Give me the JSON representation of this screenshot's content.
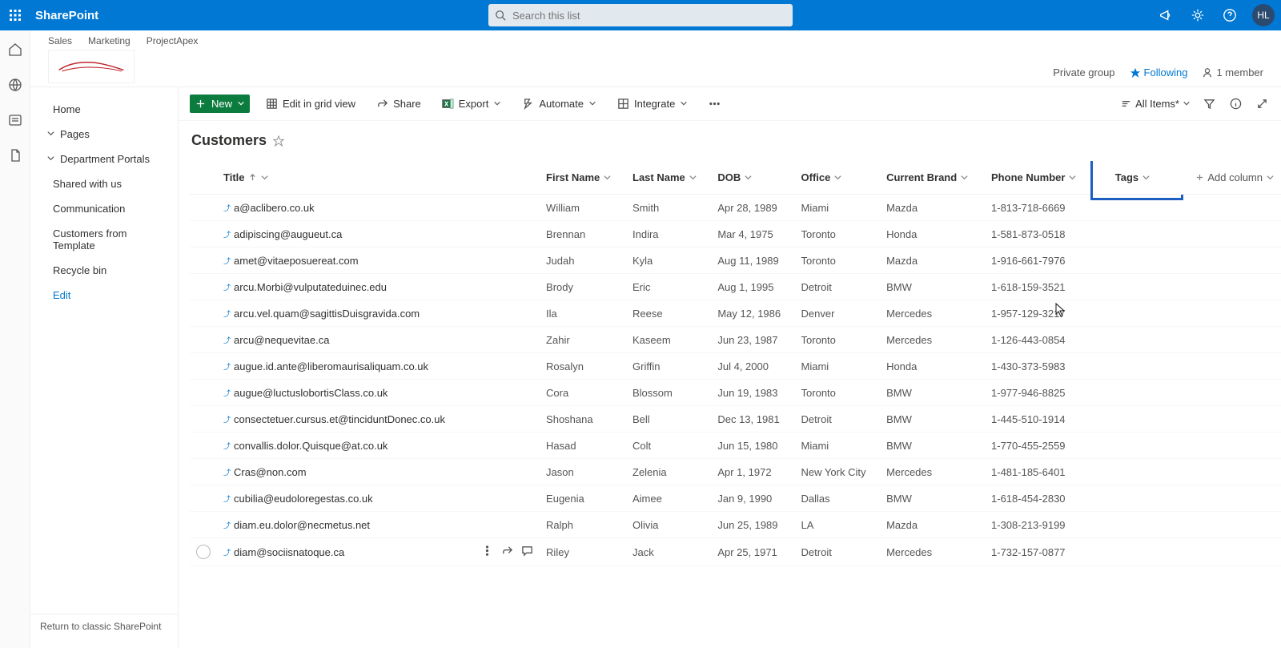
{
  "header": {
    "app_name": "SharePoint",
    "search_placeholder": "Search this list",
    "avatar_initials": "HL"
  },
  "hub": {
    "links": [
      "Sales",
      "Marketing",
      "ProjectApex"
    ],
    "private_group": "Private group",
    "following": "Following",
    "members": "1 member"
  },
  "nav": {
    "items": [
      {
        "label": "Home",
        "type": "simple"
      },
      {
        "label": "Pages",
        "type": "expand"
      },
      {
        "label": "Department Portals",
        "type": "expand"
      },
      {
        "label": "Shared with us",
        "type": "simple"
      },
      {
        "label": "Communication",
        "type": "simple"
      },
      {
        "label": "Customers from Template",
        "type": "simple"
      },
      {
        "label": "Recycle bin",
        "type": "simple"
      },
      {
        "label": "Edit",
        "type": "edit"
      }
    ],
    "classic": "Return to classic SharePoint"
  },
  "commands": {
    "new": "New",
    "edit_grid": "Edit in grid view",
    "share": "Share",
    "export": "Export",
    "automate": "Automate",
    "integrate": "Integrate",
    "view_label": "All Items*"
  },
  "list": {
    "title": "Customers",
    "columns": {
      "title": "Title",
      "first": "First Name",
      "last": "Last Name",
      "dob": "DOB",
      "office": "Office",
      "brand": "Current Brand",
      "phone": "Phone Number",
      "tags": "Tags",
      "add": "Add column"
    },
    "rows": [
      {
        "title": "a@aclibero.co.uk",
        "first": "William",
        "last": "Smith",
        "dob": "Apr 28, 1989",
        "office": "Miami",
        "brand": "Mazda",
        "phone": "1-813-718-6669"
      },
      {
        "title": "adipiscing@augueut.ca",
        "first": "Brennan",
        "last": "Indira",
        "dob": "Mar 4, 1975",
        "office": "Toronto",
        "brand": "Honda",
        "phone": "1-581-873-0518"
      },
      {
        "title": "amet@vitaeposuereat.com",
        "first": "Judah",
        "last": "Kyla",
        "dob": "Aug 11, 1989",
        "office": "Toronto",
        "brand": "Mazda",
        "phone": "1-916-661-7976"
      },
      {
        "title": "arcu.Morbi@vulputateduinec.edu",
        "first": "Brody",
        "last": "Eric",
        "dob": "Aug 1, 1995",
        "office": "Detroit",
        "brand": "BMW",
        "phone": "1-618-159-3521"
      },
      {
        "title": "arcu.vel.quam@sagittisDuisgravida.com",
        "first": "Ila",
        "last": "Reese",
        "dob": "May 12, 1986",
        "office": "Denver",
        "brand": "Mercedes",
        "phone": "1-957-129-3217"
      },
      {
        "title": "arcu@nequevitae.ca",
        "first": "Zahir",
        "last": "Kaseem",
        "dob": "Jun 23, 1987",
        "office": "Toronto",
        "brand": "Mercedes",
        "phone": "1-126-443-0854"
      },
      {
        "title": "augue.id.ante@liberomaurisaliquam.co.uk",
        "first": "Rosalyn",
        "last": "Griffin",
        "dob": "Jul 4, 2000",
        "office": "Miami",
        "brand": "Honda",
        "phone": "1-430-373-5983"
      },
      {
        "title": "augue@luctuslobortisClass.co.uk",
        "first": "Cora",
        "last": "Blossom",
        "dob": "Jun 19, 1983",
        "office": "Toronto",
        "brand": "BMW",
        "phone": "1-977-946-8825"
      },
      {
        "title": "consectetuer.cursus.et@tinciduntDonec.co.uk",
        "first": "Shoshana",
        "last": "Bell",
        "dob": "Dec 13, 1981",
        "office": "Detroit",
        "brand": "BMW",
        "phone": "1-445-510-1914"
      },
      {
        "title": "convallis.dolor.Quisque@at.co.uk",
        "first": "Hasad",
        "last": "Colt",
        "dob": "Jun 15, 1980",
        "office": "Miami",
        "brand": "BMW",
        "phone": "1-770-455-2559"
      },
      {
        "title": "Cras@non.com",
        "first": "Jason",
        "last": "Zelenia",
        "dob": "Apr 1, 1972",
        "office": "New York City",
        "brand": "Mercedes",
        "phone": "1-481-185-6401"
      },
      {
        "title": "cubilia@eudoloregestas.co.uk",
        "first": "Eugenia",
        "last": "Aimee",
        "dob": "Jan 9, 1990",
        "office": "Dallas",
        "brand": "BMW",
        "phone": "1-618-454-2830"
      },
      {
        "title": "diam.eu.dolor@necmetus.net",
        "first": "Ralph",
        "last": "Olivia",
        "dob": "Jun 25, 1989",
        "office": "LA",
        "brand": "Mazda",
        "phone": "1-308-213-9199"
      },
      {
        "title": "diam@sociisnatoque.ca",
        "first": "Riley",
        "last": "Jack",
        "dob": "Apr 25, 1971",
        "office": "Detroit",
        "brand": "Mercedes",
        "phone": "1-732-157-0877"
      }
    ]
  }
}
